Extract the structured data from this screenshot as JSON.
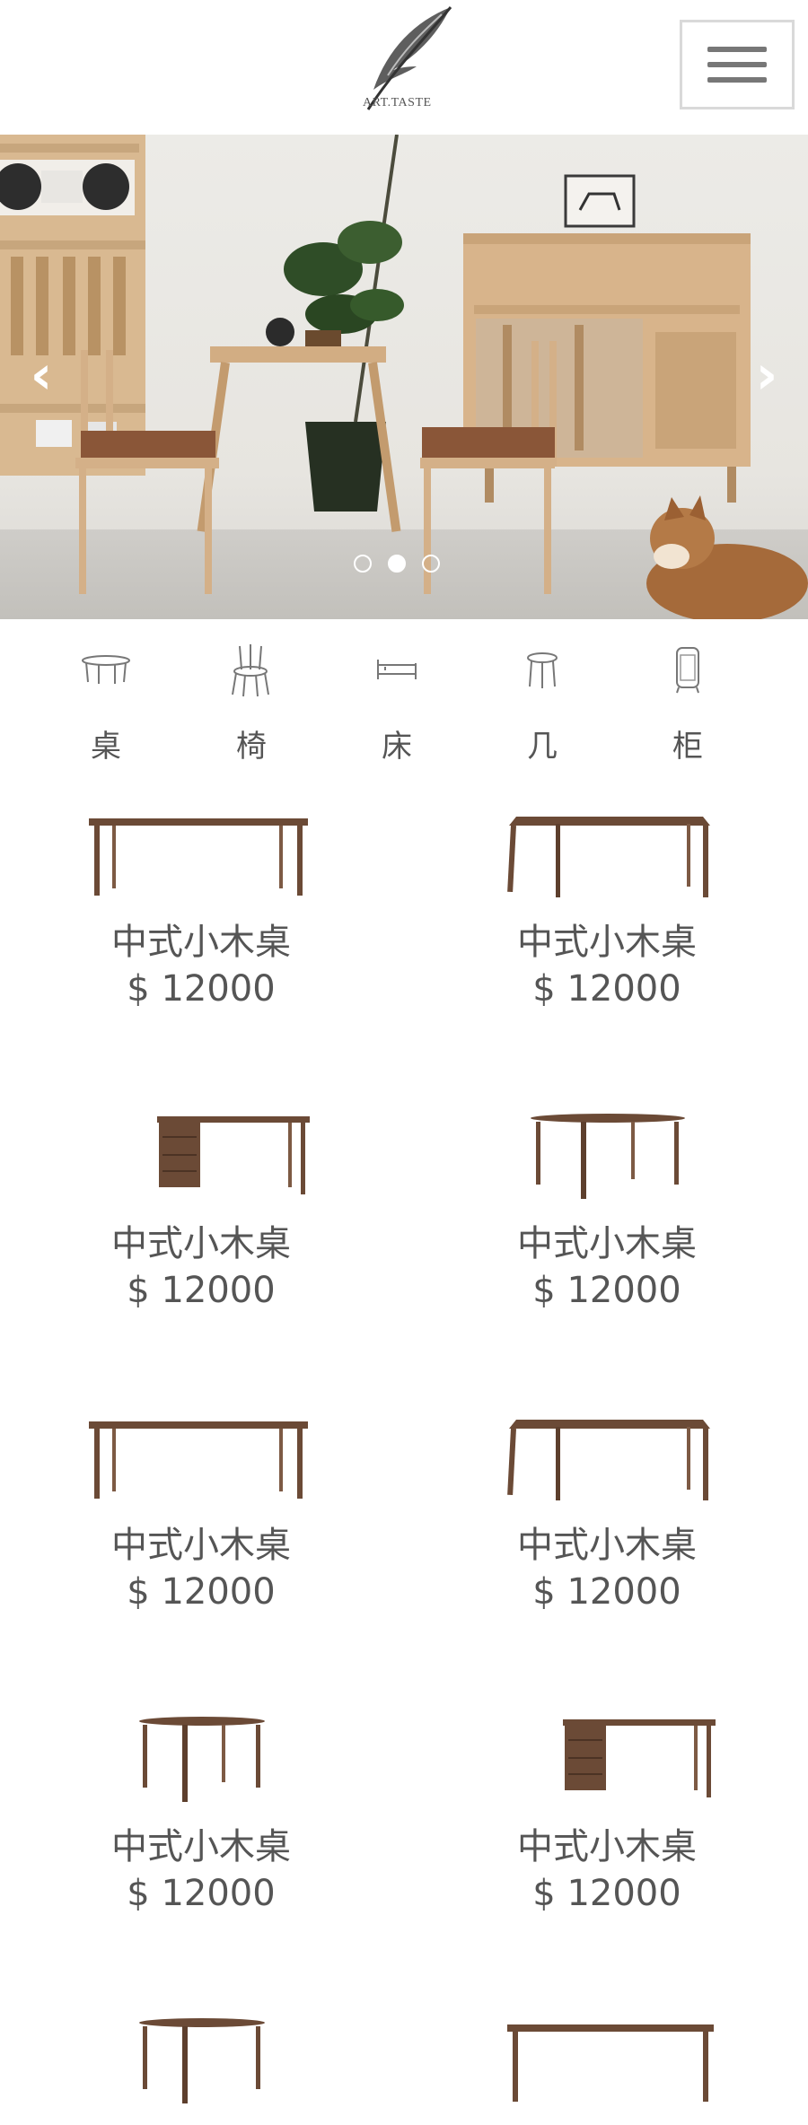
{
  "header": {
    "logo_text": "ART.TASTE"
  },
  "hero": {
    "prev_label": "‹",
    "next_label": "›",
    "slides": 3,
    "active_slide": 2
  },
  "categories": [
    {
      "label": "桌",
      "icon": "table-icon"
    },
    {
      "label": "椅",
      "icon": "chair-icon"
    },
    {
      "label": "床",
      "icon": "bed-icon"
    },
    {
      "label": "几",
      "icon": "side-table-icon"
    },
    {
      "label": "柜",
      "icon": "cabinet-icon"
    }
  ],
  "products": [
    {
      "name": "中式小木桌",
      "price": "$ 12000",
      "image": "long-table"
    },
    {
      "name": "中式小木桌",
      "price": "$ 12000",
      "image": "long-table-angled"
    },
    {
      "name": "中式小木桌",
      "price": "$ 12000",
      "image": "desk-with-drawers"
    },
    {
      "name": "中式小木桌",
      "price": "$ 12000",
      "image": "round-table"
    },
    {
      "name": "中式小木桌",
      "price": "$ 12000",
      "image": "long-table"
    },
    {
      "name": "中式小木桌",
      "price": "$ 12000",
      "image": "long-table-angled"
    },
    {
      "name": "中式小木桌",
      "price": "$ 12000",
      "image": "round-table"
    },
    {
      "name": "中式小木桌",
      "price": "$ 12000",
      "image": "desk-with-drawers"
    },
    {
      "name": "",
      "price": "",
      "image": "round-table"
    },
    {
      "name": "",
      "price": "",
      "image": "long-table"
    }
  ],
  "colors": {
    "wood": "#6b4a36",
    "text": "#555555"
  }
}
